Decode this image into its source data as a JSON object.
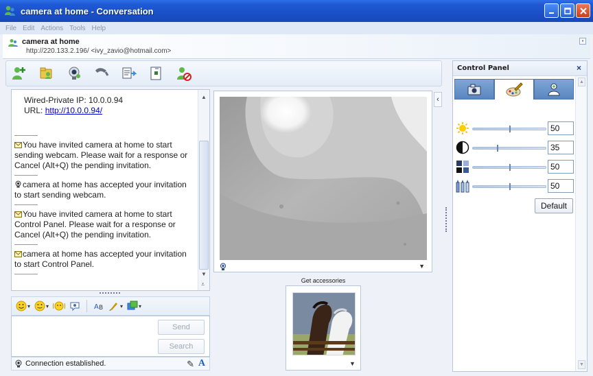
{
  "window": {
    "title": "camera at home - Conversation"
  },
  "menu": [
    "File",
    "Edit",
    "Actions",
    "Tools",
    "Help"
  ],
  "contact": {
    "name": "camera at home",
    "address": "http://220.133.2.196/ <ivy_zavio@hotmail.com>"
  },
  "toolbar": {
    "icons": [
      "invite-contact-icon",
      "send-files-icon",
      "webcam-icon",
      "call-icon",
      "share-icon",
      "activities-icon",
      "block-icon"
    ]
  },
  "history": {
    "ip_line": "Wired-Private IP: 10.0.0.94",
    "url_label": "URL: ",
    "url_link": "http://10.0.0.94/",
    "messages": [
      "You have invited camera at home to start sending webcam. Please wait for a response or Cancel (Alt+Q) the pending invitation.",
      "camera at home has accepted your invitation to start sending webcam.",
      "You have invited camera at home to start Control Panel. Please wait for a response or Cancel (Alt+Q) the pending invitation.",
      "camera at home has accepted your invitation to start Control Panel."
    ]
  },
  "compose": {
    "send_label": "Send",
    "search_label": "Search"
  },
  "status": {
    "text": "Connection established."
  },
  "accessories": {
    "label": "Get accessories"
  },
  "control_panel": {
    "title": "Control Panel",
    "close": "×",
    "tabs": [
      "camera-icon",
      "paint-brush-icon",
      "user-icon"
    ],
    "sliders": [
      {
        "name": "brightness",
        "value": "50"
      },
      {
        "name": "contrast",
        "value": "35"
      },
      {
        "name": "color",
        "value": "50"
      },
      {
        "name": "saturation",
        "value": "50"
      }
    ],
    "default_label": "Default"
  }
}
